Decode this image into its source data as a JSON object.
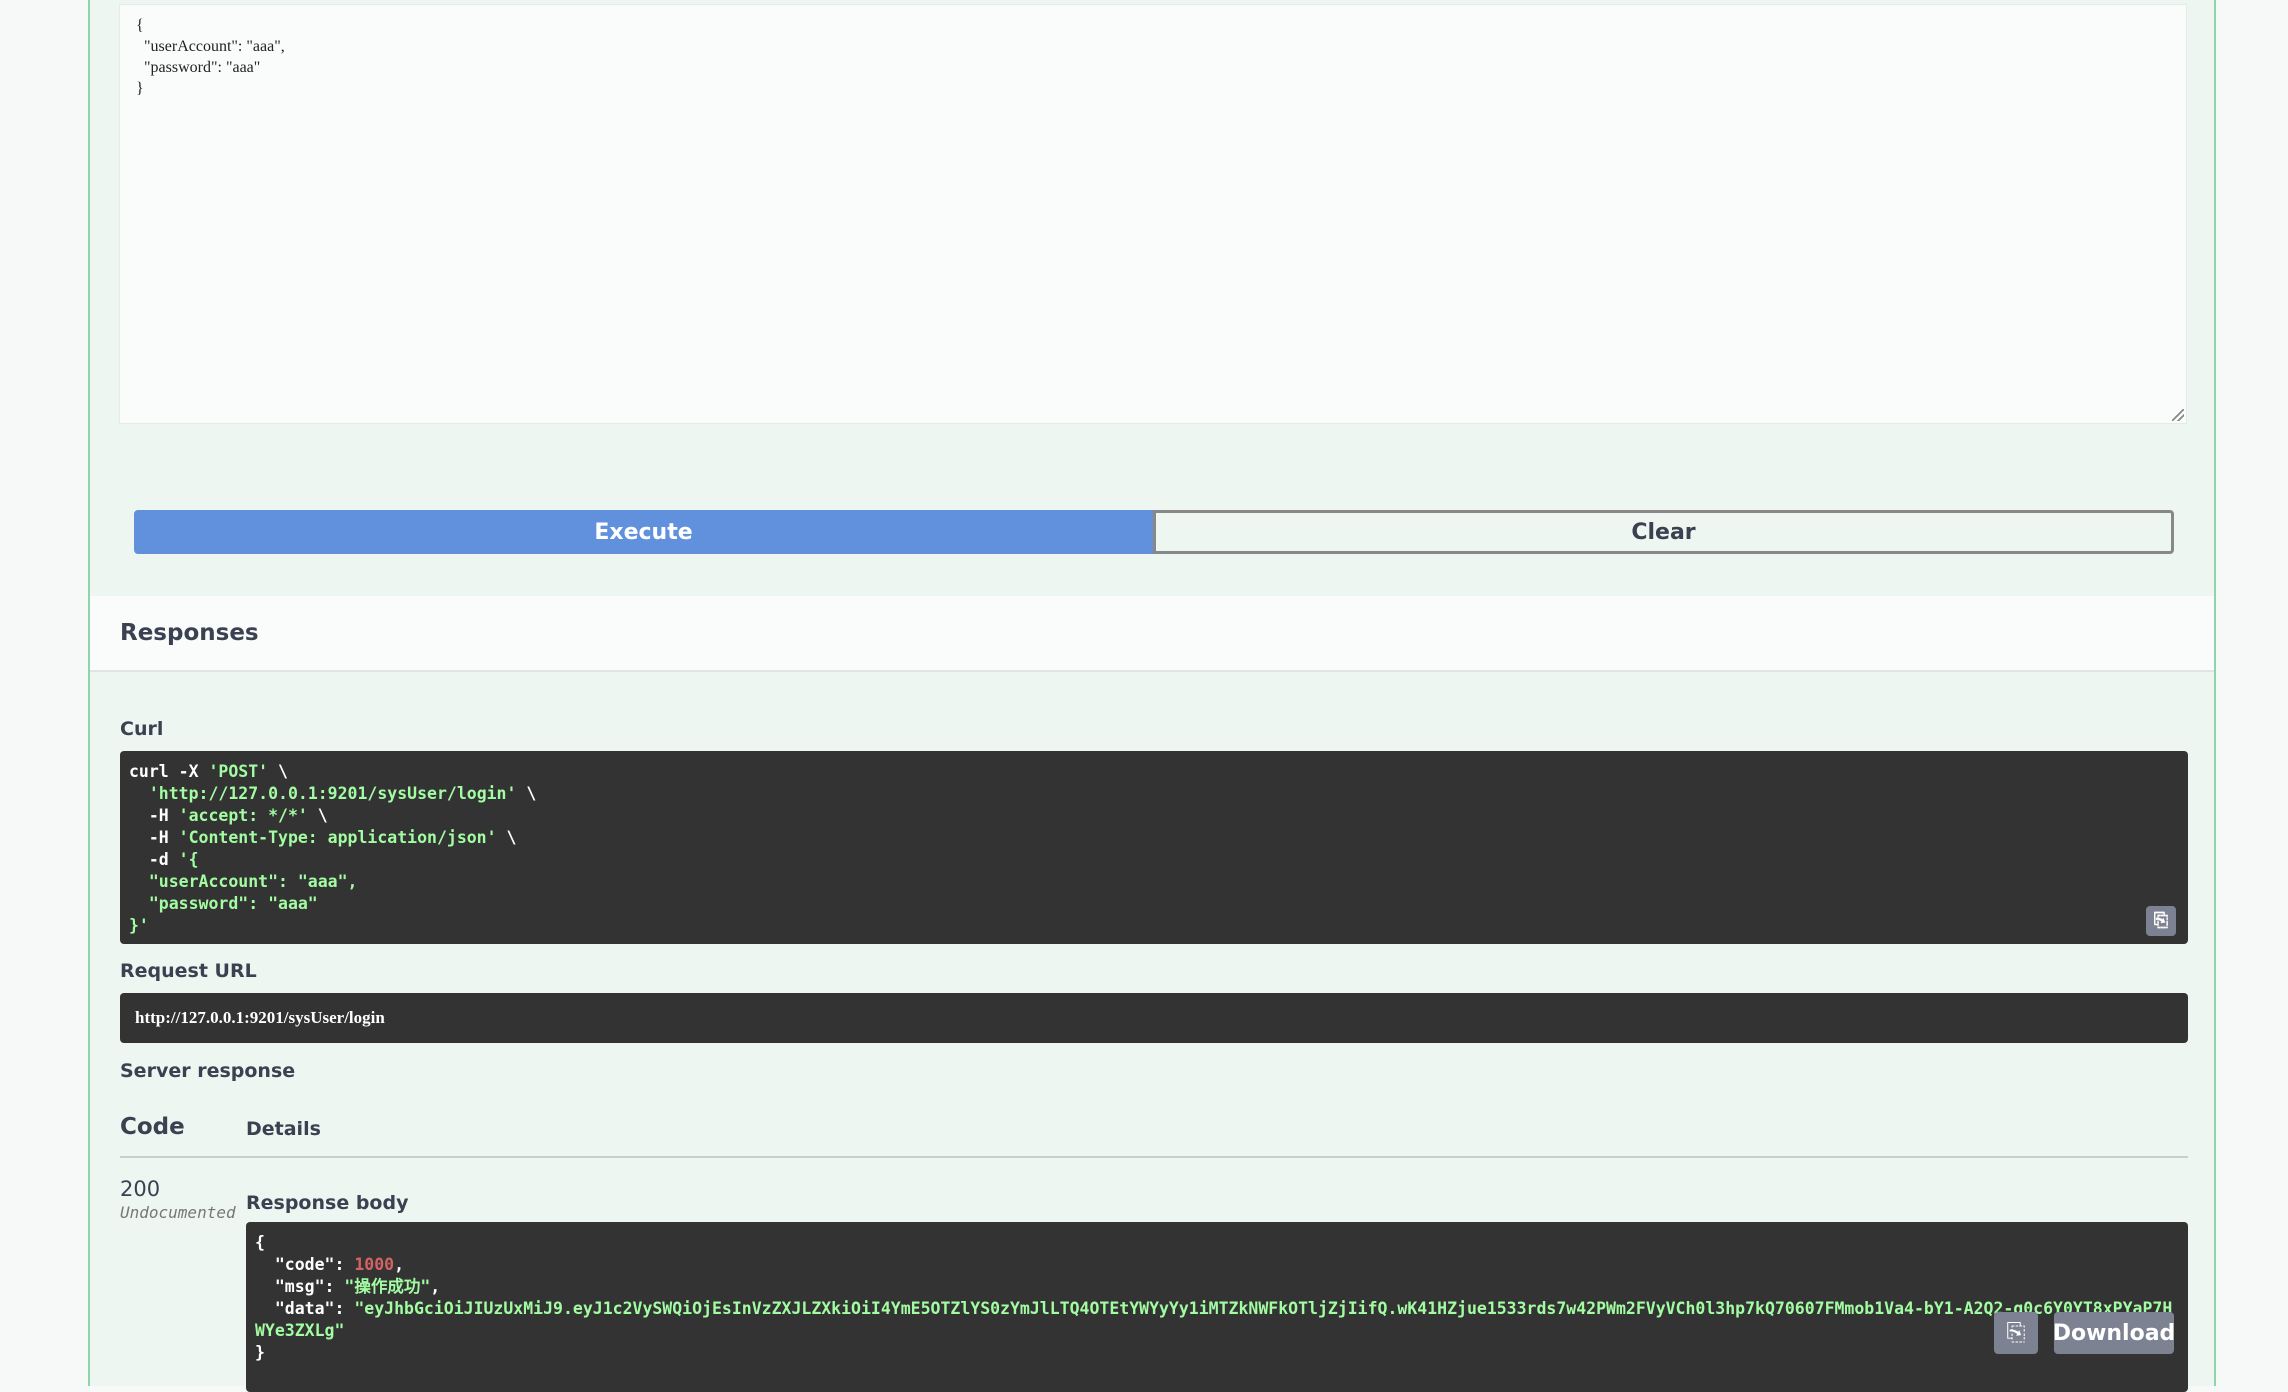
{
  "request_body": {
    "lines": [
      "{",
      "  \"userAccount\": \"aaa\",",
      "  \"password\": \"aaa\"",
      "}"
    ]
  },
  "buttons": {
    "execute": "Execute",
    "clear": "Clear"
  },
  "responses": {
    "title": "Responses",
    "curl_label": "Curl",
    "curl": {
      "line1a": "curl -X ",
      "line1b": "'POST'",
      "line1c": " \\",
      "line2a": "  ",
      "line2b": "'http://127.0.0.1:9201/sysUser/login'",
      "line2c": " \\",
      "line3a": "  -H ",
      "line3b": "'accept: */*'",
      "line3c": " \\",
      "line4a": "  -H ",
      "line4b": "'Content-Type: application/json'",
      "line4c": " \\",
      "line5a": "  -d ",
      "line5b": "'{",
      "line6": "  \"userAccount\": \"aaa\",",
      "line7": "  \"password\": \"aaa\"",
      "line8": "}'"
    },
    "request_url_label": "Request URL",
    "request_url": "http://127.0.0.1:9201/sysUser/login",
    "server_response_label": "Server response",
    "table": {
      "code_header": "Code",
      "details_header": "Details"
    },
    "status_code": "200",
    "status_note": "Undocumented",
    "response_body_label": "Response body",
    "response_body": {
      "open": "{",
      "code_key": "  \"code\": ",
      "code_val": "1000",
      "code_end": ",",
      "msg_key": "  \"msg\": ",
      "msg_val": "\"操作成功\"",
      "msg_end": ",",
      "data_key": "  \"data\": ",
      "data_val": "\"eyJhbGciOiJIUzUxMiJ9.eyJ1c2VySWQiOjEsInVzZXJLZXkiOiI4YmE5OTZlYS0zYmJlLTQ4OTEtYWYyYy1iMTZkNWFkOTljZjIifQ.wK41HZjue1533rds7w42PWm2FVyVCh0l3hp7kQ70607FMmob1Va4-bY1-A2Q2-g0c6Y0YT8xPYaP7HWYe3ZXLg\"",
      "close": "}"
    },
    "download_label": "Download"
  },
  "icons": {
    "copy": "clipboard-icon",
    "resize": "resize-grip-icon"
  }
}
